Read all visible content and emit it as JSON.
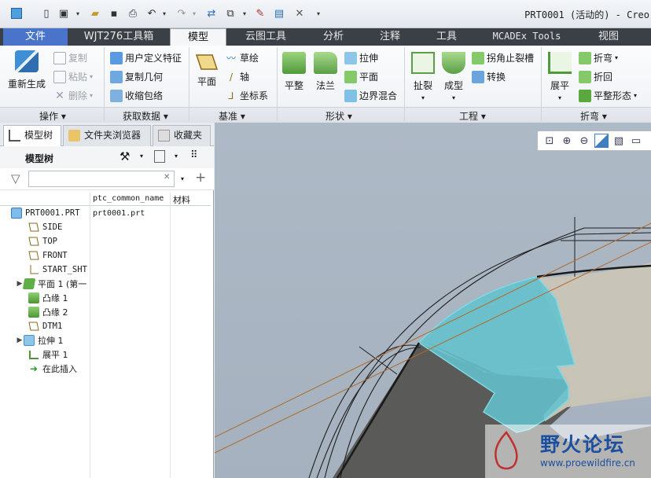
{
  "window": {
    "title": "PRT0001 (活动的) - Creo"
  },
  "quick_access": {
    "icons": [
      "app-icon",
      "new-icon",
      "window-icon",
      "open-icon",
      "save-icon",
      "print-icon",
      "undo-icon",
      "redo-icon",
      "regenerate-icon",
      "windows-icon",
      "edit-icon",
      "screen-icon",
      "close-icon",
      "customize-icon"
    ]
  },
  "tabs": [
    {
      "label": "文件"
    },
    {
      "label": "WJT276工具箱"
    },
    {
      "label": "模型"
    },
    {
      "label": "云图工具"
    },
    {
      "label": "分析"
    },
    {
      "label": "注释"
    },
    {
      "label": "工具"
    },
    {
      "label": "MCADEx Tools"
    },
    {
      "label": "视图"
    }
  ],
  "ribbon": {
    "operations": {
      "regen": "重新生成",
      "copy": "复制",
      "paste": "粘贴",
      "delete": "删除",
      "group": "操作"
    },
    "get_data": {
      "udf": "用户定义特征",
      "copy_geom": "复制几何",
      "shrinkwrap": "收缩包络",
      "group": "获取数据"
    },
    "datum": {
      "plane": "平面",
      "sketch": "草绘",
      "axis": "轴",
      "csys": "坐标系",
      "group": "基准"
    },
    "shapes": {
      "flat": "平整",
      "flange": "法兰",
      "extrude": "拉伸",
      "plane": "平面",
      "blend": "边界混合",
      "group": "形状"
    },
    "engineering": {
      "rip": "扯裂",
      "form": "成型",
      "corner_relief": "拐角止裂槽",
      "convert": "转换",
      "group": "工程"
    },
    "bends": {
      "unbend": "展平",
      "bend": "折弯",
      "bend_back": "折回",
      "flat_pattern": "平整形态",
      "group": "折弯"
    }
  },
  "panel": {
    "tabs": [
      {
        "label": "模型树"
      },
      {
        "label": "文件夹浏览器"
      },
      {
        "label": "收藏夹"
      }
    ],
    "header": "模型树",
    "search": {
      "placeholder": "",
      "value": ""
    },
    "columns": {
      "name_col": "ptc_common_name",
      "material": "材料"
    },
    "tree": [
      {
        "name": "PRT0001.PRT",
        "common": "prt0001.prt",
        "icon": "part-icon",
        "expand": false
      },
      {
        "name": "SIDE",
        "icon": "datum-plane-icon",
        "expand": false
      },
      {
        "name": "TOP",
        "icon": "datum-plane-icon",
        "expand": false
      },
      {
        "name": "FRONT",
        "icon": "datum-plane-icon",
        "expand": false
      },
      {
        "name": "START_SHT",
        "icon": "csys-icon",
        "expand": false
      },
      {
        "name": "平面 1 (第一",
        "icon": "planar-wall-icon",
        "expand": true
      },
      {
        "name": "凸缘 1",
        "icon": "flange-icon",
        "expand": false
      },
      {
        "name": "凸缘 2",
        "icon": "flange-icon",
        "expand": false
      },
      {
        "name": "DTM1",
        "icon": "datum-plane-icon",
        "expand": false
      },
      {
        "name": "拉伸 1",
        "icon": "extrude-icon",
        "expand": true
      },
      {
        "name": "展平 1",
        "icon": "unbend-icon",
        "expand": false
      },
      {
        "name": "在此插入",
        "icon": "insert-here-icon",
        "expand": false
      }
    ]
  },
  "viewport": {
    "toolbar_icons": [
      "zoom-fit-icon",
      "zoom-in-icon",
      "zoom-out-icon",
      "repaint-icon",
      "display-style-icon",
      "named-views-icon"
    ],
    "watermark": {
      "brand": "野火论坛",
      "url": "www.proewildfire.cn"
    },
    "colors": {
      "selection": "#5fc4cf",
      "surface": "#c9c5ba",
      "edge": "#1e1e1e",
      "datum_line": "#b06a2a"
    }
  }
}
